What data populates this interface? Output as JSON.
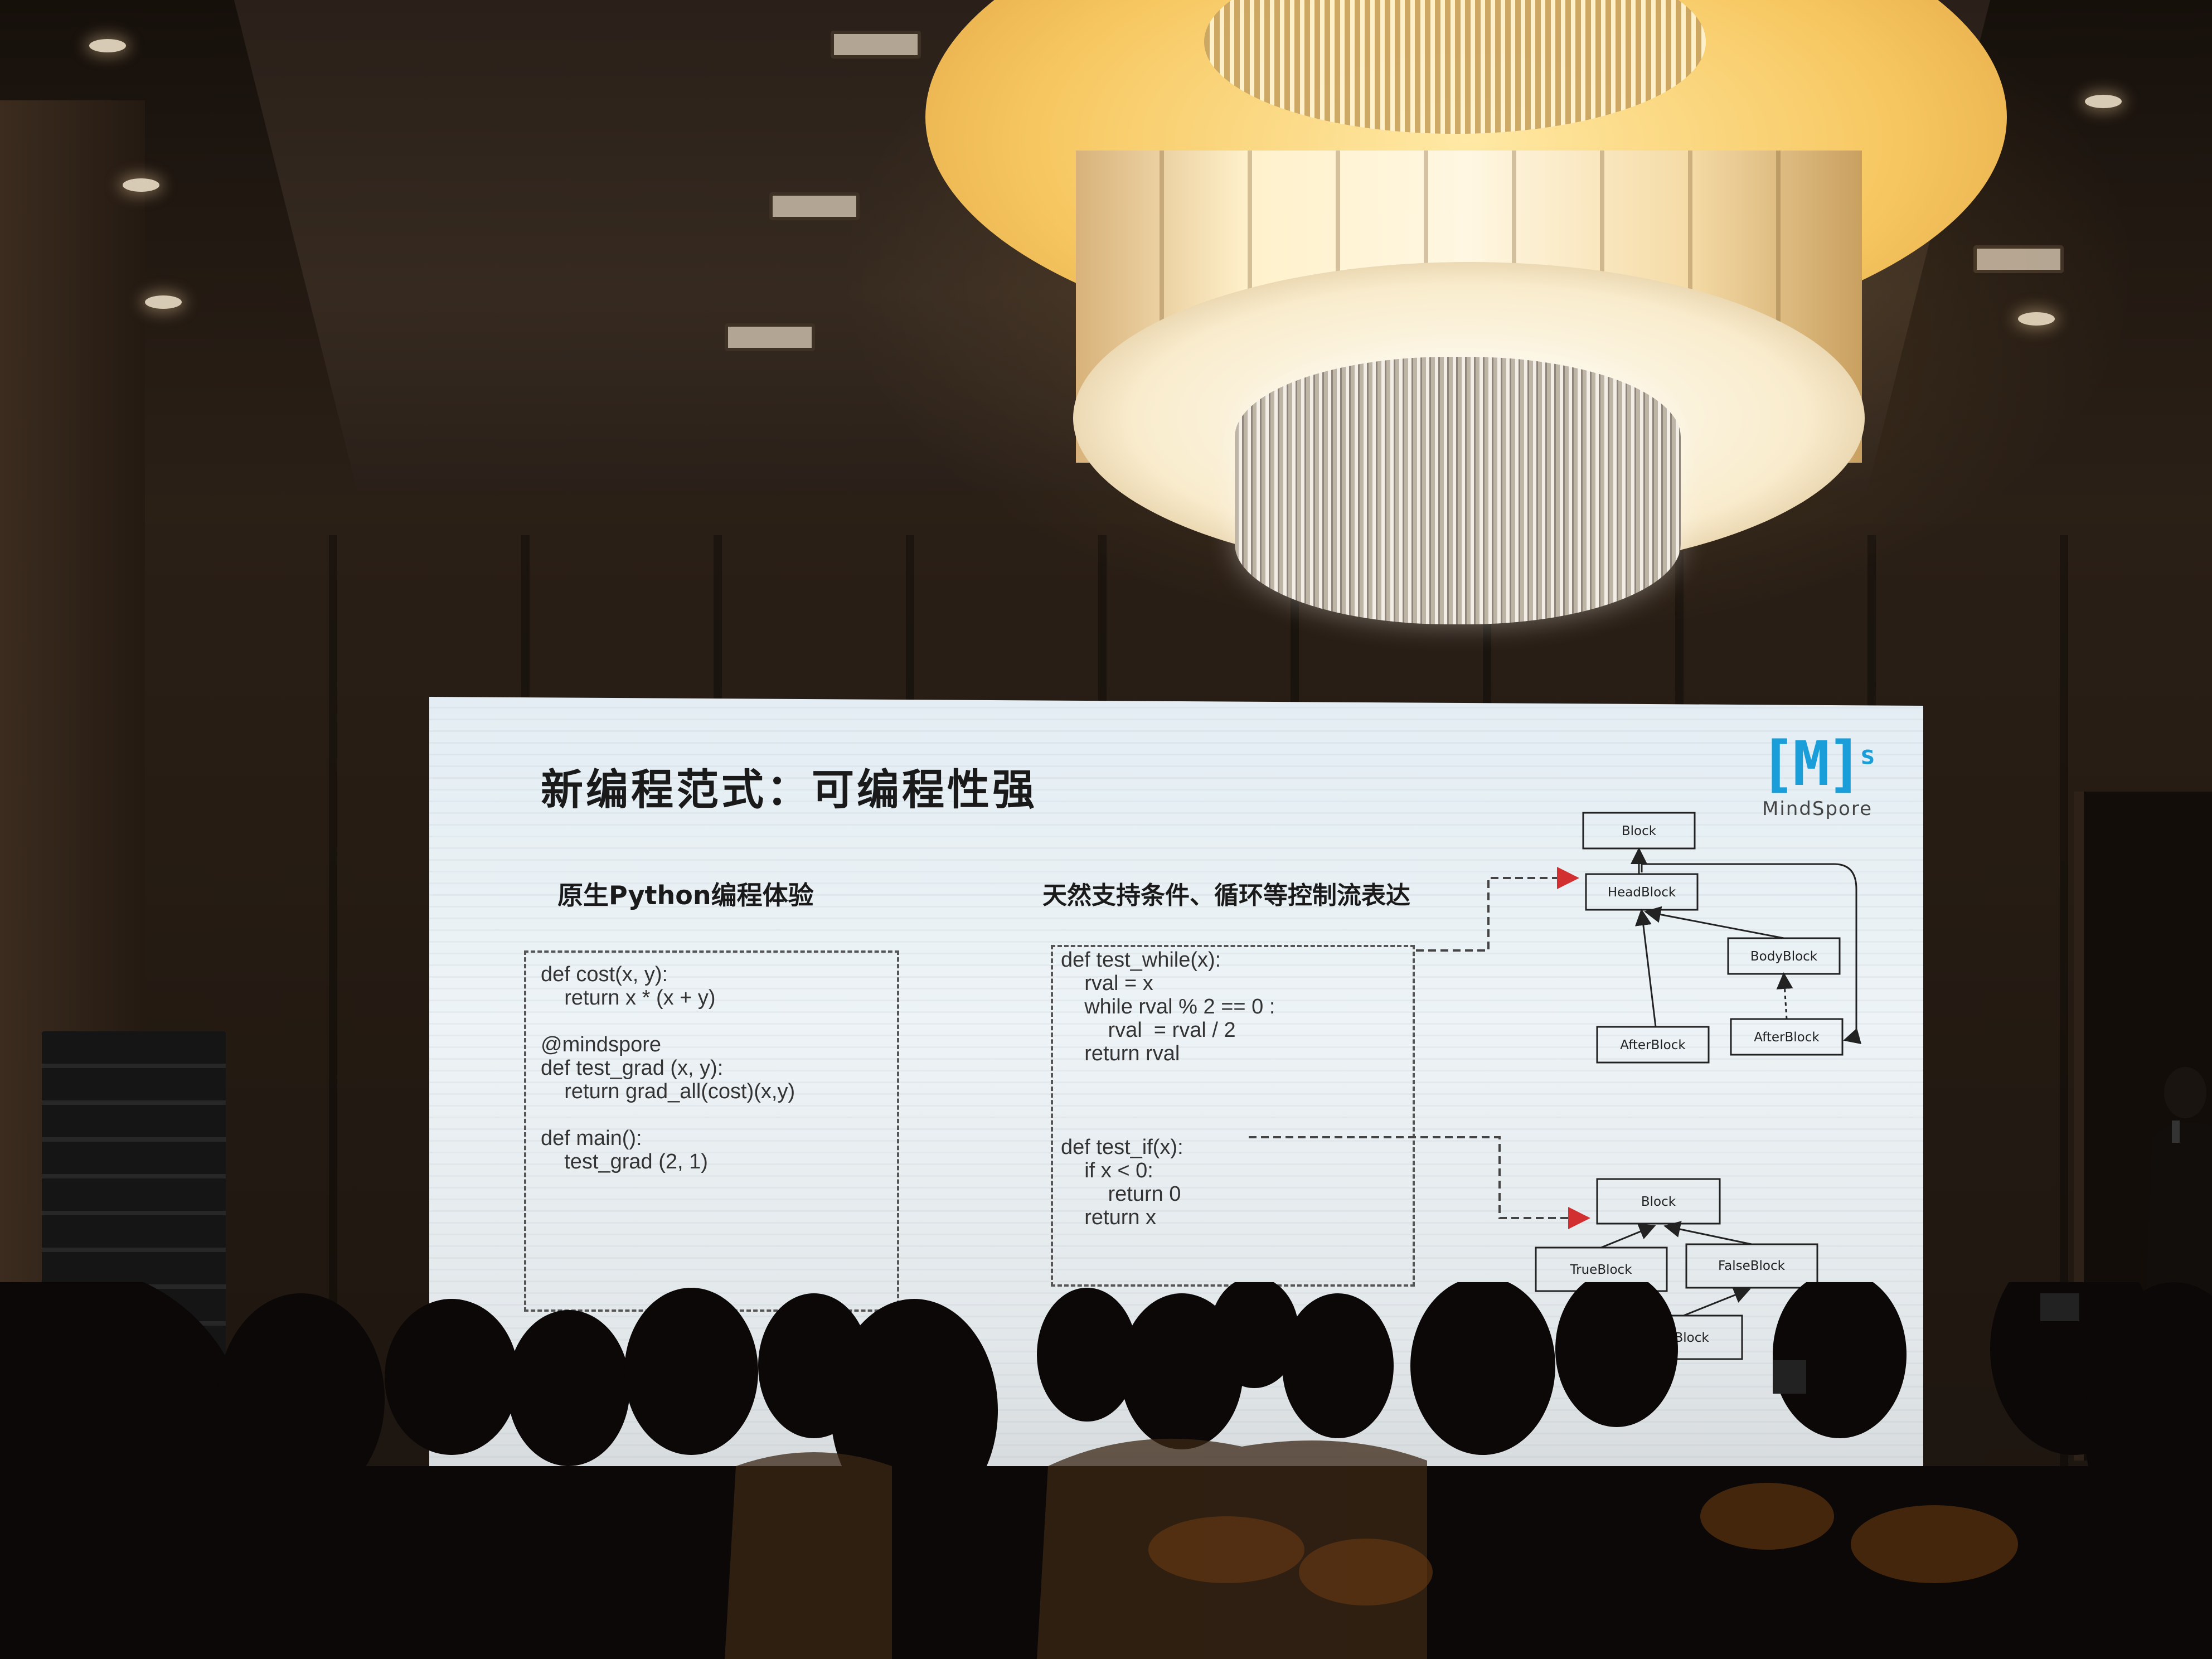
{
  "slide": {
    "title": "新编程范式：可编程性强",
    "logo": {
      "mark": "[M]",
      "superscript": "s",
      "name": "MindSpore"
    },
    "left_heading": "原生Python编程体验",
    "right_heading": "天然支持条件、循环等控制流表达",
    "left_code": "def cost(x, y):\n    return x * (x + y)\n\n@mindspore\ndef test_grad (x, y):\n    return grad_all(cost)(x,y)\n\ndef main():\n    test_grad (2, 1)",
    "right_code": "def test_while(x):\n    rval = x\n    while rval % 2 == 0 :\n        rval  = rval / 2\n    return rval\n\n\n\ndef test_if(x):\n    if x < 0:\n        return 0\n    return x",
    "while_diagram": {
      "block": "Block",
      "head": "HeadBlock",
      "body": "BodyBlock",
      "after_left": "AfterBlock",
      "after_right": "AfterBlock"
    },
    "if_diagram": {
      "block": "Block",
      "true_block": "TrueBlock",
      "false_block": "FalseBlock",
      "after": "AfterBlock"
    },
    "colors": {
      "logo": "#1a9ed9",
      "arrow_red": "#d23030",
      "text": "#1a1a1a"
    }
  }
}
